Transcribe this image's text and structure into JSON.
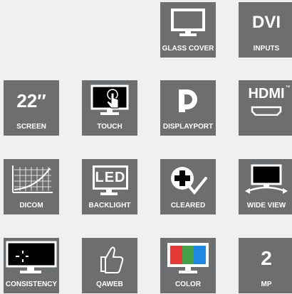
{
  "features": {
    "glass_cover": {
      "label": "GLASS COVER",
      "icon": "monitor-icon"
    },
    "dvi": {
      "label": "INPUTS",
      "big": "DVI",
      "icon": "dvi-text"
    },
    "screen": {
      "label": "SCREEN",
      "big": "22″",
      "icon": "size-text"
    },
    "touch": {
      "label": "TOUCH",
      "icon": "touch-monitor-icon"
    },
    "displayport": {
      "label": "DISPLAYPORT",
      "icon": "displayport-icon"
    },
    "hdmi": {
      "label": "",
      "big": "HDMI",
      "tm": "™",
      "icon": "hdmi-icon"
    },
    "dicom": {
      "label": "DICOM",
      "icon": "dicom-curve-icon"
    },
    "backlight": {
      "label": "BACKLIGHT",
      "big": "LED",
      "icon": "led-monitor-icon"
    },
    "cleared": {
      "label": "CLEARED",
      "icon": "medical-cross-check-icon"
    },
    "wide_view": {
      "label": "WIDE VIEW",
      "icon": "wide-view-monitor-icon"
    },
    "consistency": {
      "label": "CONSISTENCY",
      "icon": "consistency-monitor-icon"
    },
    "qaweb": {
      "label": "QAWEB",
      "icon": "thumbs-up-icon"
    },
    "color": {
      "label": "COLOR",
      "icon": "rgb-monitor-icon"
    },
    "mp": {
      "label": "MP",
      "big": "2",
      "icon": "mp-text"
    }
  },
  "colors": {
    "tile": "#6d6e70",
    "red": "#e53935",
    "green": "#43a047",
    "blue": "#1e88e5"
  }
}
